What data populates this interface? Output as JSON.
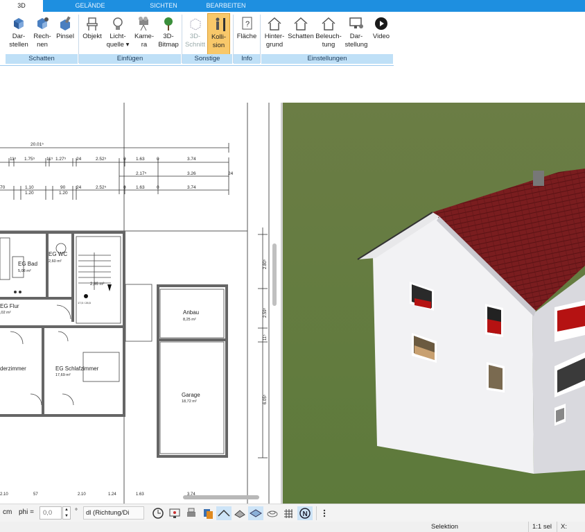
{
  "tabs": {
    "t3d": "3D",
    "gelaende": "GELÄNDE",
    "sichten": "SICHTEN",
    "bearbeiten": "BEARBEITEN"
  },
  "ribbon": {
    "darstellen": "Dar-\nstellen",
    "rechnen": "Rech-\nnen",
    "pinsel": "Pinsel",
    "objekt": "Objekt",
    "lichtquelle": "Licht-\nquelle ▾",
    "kamera": "Kame-\nra",
    "bitmap3d": "3D-\nBitmap",
    "schnitt3d": "3D-\nSchnitt",
    "kollision": "Kolli-\nsion",
    "flaeche": "Fläche",
    "hintergrund": "Hinter-\ngrund",
    "schatten": "Schatten",
    "beleuchtung": "Beleuch-\ntung",
    "darstellung": "Dar-\nstellung",
    "video": "Video",
    "groups": {
      "schatten": "Schatten",
      "einfuegen": "Einfügen",
      "sonstige": "Sonstige",
      "info": "Info",
      "einstellungen": "Einstellungen"
    }
  },
  "plan": {
    "dims_top": "20.01⁵",
    "row1": [
      "11⁵",
      "1.75⁵",
      "11⁵",
      "1.27⁵",
      "24",
      "2.52⁵",
      "0",
      "1.63",
      "0",
      "3.74"
    ],
    "row2": [
      "2.17⁵",
      "3.26",
      "24"
    ],
    "row3": [
      "70",
      "1.10",
      "1.20",
      "90",
      "1.20",
      "24",
      "2.52⁵",
      "0",
      "1.63",
      "0",
      "3.74"
    ],
    "rooms": [
      {
        "name": "EG Bad",
        "area": "5,08 m²"
      },
      {
        "name": "EG WC",
        "area": "2,60 m²"
      },
      {
        "name": "EG Flur",
        "area": ",02 m²"
      },
      {
        "name": "",
        "area": "2,86 m²"
      },
      {
        "name": "derzimmer",
        "area": ""
      },
      {
        "name": "EG Schlafzimmer",
        "area": "17,69 m²"
      },
      {
        "name": "Anbau",
        "area": "8,25 m²"
      },
      {
        "name": "Garage",
        "area": "18,72 m²"
      }
    ],
    "stairs_label": "17,5 / 28,5",
    "vert_dims": [
      "2.80⁵",
      "2.59⁵",
      "11⁵",
      "6.05⁵"
    ],
    "bottom_dims": [
      "2.10",
      "57",
      "2.10",
      "1.24",
      "1.63",
      "3.74"
    ]
  },
  "toolbar": {
    "unit": "cm",
    "phi_label": "phi =",
    "phi_value": "0,0",
    "deg": "°",
    "dl_select": "dl (Richtung/Di"
  },
  "status": {
    "selektion": "Selektion",
    "scale": "1:1 sel",
    "x": "X:"
  }
}
